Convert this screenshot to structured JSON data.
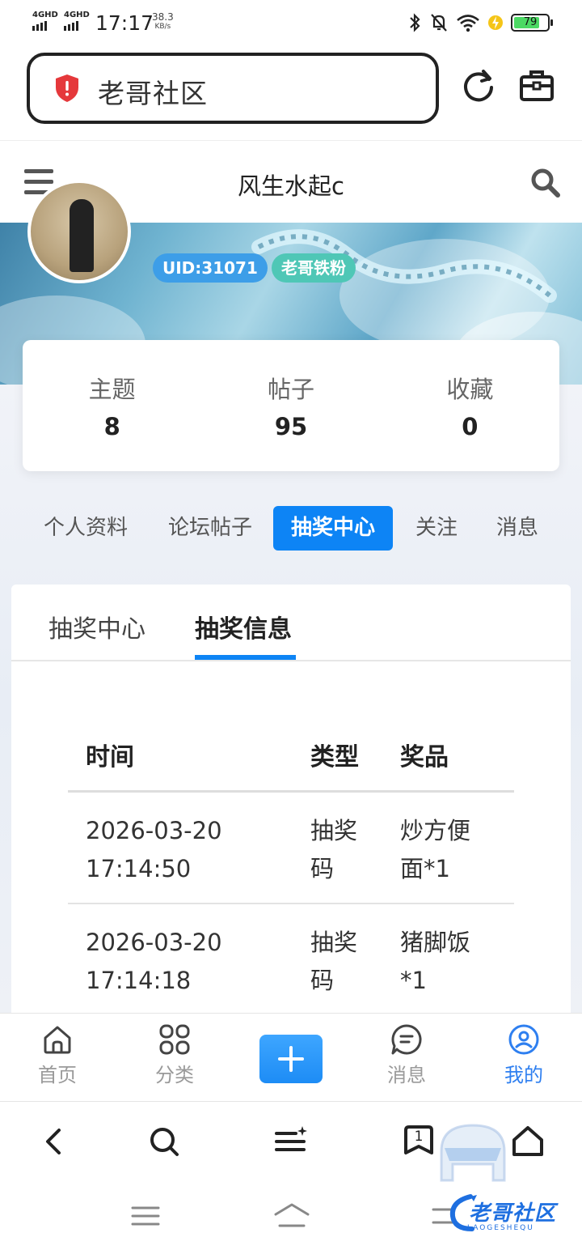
{
  "status_bar": {
    "network1": "4GHD",
    "network2": "4GHD",
    "time": "17:17",
    "speed_value": "38.3",
    "speed_unit": "KB/s",
    "battery_percent": "79",
    "battery_level": 0.79,
    "icons": [
      "bluetooth-icon",
      "bell-muted-icon",
      "wifi-icon",
      "charging-icon",
      "battery-icon"
    ]
  },
  "browser": {
    "url_text": "老哥社区",
    "icons": [
      "security-shield-icon",
      "refresh-icon",
      "toolbox-icon"
    ]
  },
  "page_header": {
    "title": "风生水起c",
    "icons": [
      "menu-icon",
      "search-icon"
    ]
  },
  "profile": {
    "uid_badge": "UID:31071",
    "group_badge": "老哥铁粉",
    "stats": [
      {
        "label": "主题",
        "value": "8"
      },
      {
        "label": "帖子",
        "value": "95"
      },
      {
        "label": "收藏",
        "value": "0"
      }
    ]
  },
  "profile_tabs": [
    {
      "label": "个人资料",
      "active": false
    },
    {
      "label": "论坛帖子",
      "active": false
    },
    {
      "label": "抽奖中心",
      "active": true
    },
    {
      "label": "关注",
      "active": false
    },
    {
      "label": "消息",
      "active": false
    }
  ],
  "content_tabs": [
    {
      "label": "抽奖中心",
      "active": false
    },
    {
      "label": "抽奖信息",
      "active": true
    }
  ],
  "lottery_table": {
    "headers": [
      "时间",
      "类型",
      "奖品"
    ],
    "rows": [
      {
        "time_date": "2026-03-20",
        "time_clock": "17:14:50",
        "type_line1": "抽奖",
        "type_line2": "码",
        "prize_line1": "炒方便",
        "prize_line2": "面*1"
      },
      {
        "time_date": "2026-03-20",
        "time_clock": "17:14:18",
        "type_line1": "抽奖",
        "type_line2": "码",
        "prize_line1": "猪脚饭",
        "prize_line2": "*1"
      }
    ]
  },
  "app_nav": [
    {
      "label": "首页",
      "icon": "home-icon",
      "active": false
    },
    {
      "label": "分类",
      "icon": "grid-icon",
      "active": false
    },
    {
      "label": "",
      "icon": "plus-icon",
      "active": false
    },
    {
      "label": "消息",
      "icon": "chat-icon",
      "active": false
    },
    {
      "label": "我的",
      "icon": "user-icon",
      "active": true
    }
  ],
  "browser_nav": {
    "tab_count": "1",
    "icons": [
      "back-icon",
      "search-icon",
      "menu-sparkle-icon",
      "tabs-icon",
      "home-icon"
    ]
  },
  "watermark": {
    "text": "老哥社区",
    "sub": "LAOGESHEQU"
  },
  "colors": {
    "accent": "#0d84f5",
    "uid_badge": "#3d9ee8",
    "group_badge": "#4fc7b6",
    "shield": "#e5383b"
  }
}
